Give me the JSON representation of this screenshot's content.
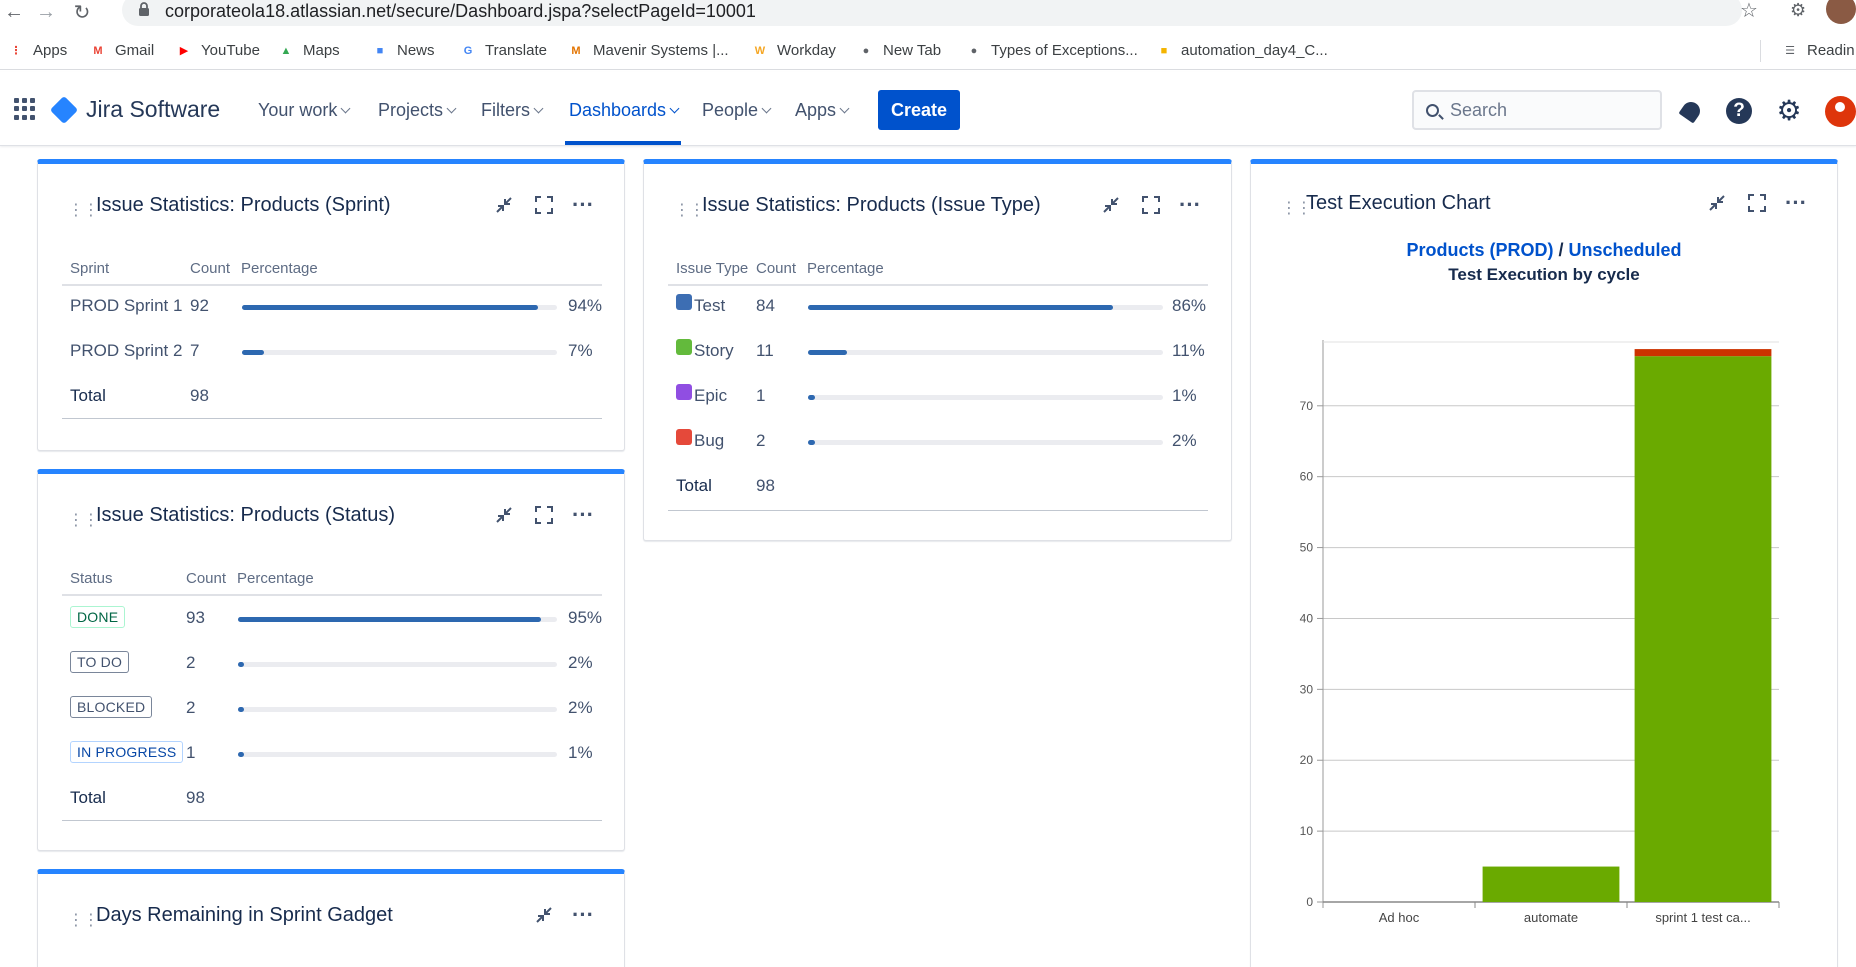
{
  "browser": {
    "url": "corporateola18.atlassian.net/secure/Dashboard.jspa?selectPageId=10001",
    "bookmarks": [
      {
        "label": "Apps",
        "icon": "apps-grid-icon",
        "color": "#ea4335"
      },
      {
        "label": "Gmail",
        "icon": "gmail-icon",
        "color": "#ea4335"
      },
      {
        "label": "YouTube",
        "icon": "youtube-icon",
        "color": "#ff0000"
      },
      {
        "label": "Maps",
        "icon": "maps-icon",
        "color": "#34a853"
      },
      {
        "label": "News",
        "icon": "news-icon",
        "color": "#4285f4"
      },
      {
        "label": "Translate",
        "icon": "translate-icon",
        "color": "#4285f4"
      },
      {
        "label": "Mavenir Systems |...",
        "icon": "mavenir-icon",
        "color": "#e37400"
      },
      {
        "label": "Workday",
        "icon": "workday-icon",
        "color": "#f5a623"
      },
      {
        "label": "New Tab",
        "icon": "globe-icon",
        "color": "#5f6368"
      },
      {
        "label": "Types of Exceptions...",
        "icon": "globe-icon",
        "color": "#5f6368"
      },
      {
        "label": "automation_day4_C...",
        "icon": "slides-icon",
        "color": "#f4b400"
      }
    ],
    "reading_list": "Readin"
  },
  "header": {
    "product": "Jira Software",
    "nav": [
      {
        "label": "Your work",
        "active": false
      },
      {
        "label": "Projects",
        "active": false
      },
      {
        "label": "Filters",
        "active": false
      },
      {
        "label": "Dashboards",
        "active": true
      },
      {
        "label": "People",
        "active": false
      },
      {
        "label": "Apps",
        "active": false
      }
    ],
    "create_label": "Create",
    "search_placeholder": "Search",
    "help_glyph": "?"
  },
  "gadgets": {
    "sprint": {
      "title": "Issue Statistics: Products (Sprint)",
      "columns": [
        "Sprint",
        "Count",
        "Percentage"
      ],
      "rows": [
        {
          "label": "PROD Sprint 1",
          "count": "92",
          "percent": "94%",
          "fraction": 0.94
        },
        {
          "label": "PROD Sprint 2",
          "count": "7",
          "percent": "7%",
          "fraction": 0.07
        }
      ],
      "total_label": "Total",
      "total": "98"
    },
    "issue_type": {
      "title": "Issue Statistics: Products (Issue Type)",
      "columns": [
        "Issue Type",
        "Count",
        "Percentage"
      ],
      "rows": [
        {
          "label": "Test",
          "count": "84",
          "percent": "86%",
          "fraction": 0.86,
          "icon": "test-icon",
          "color": "#3d6eb3"
        },
        {
          "label": "Story",
          "count": "11",
          "percent": "11%",
          "fraction": 0.11,
          "icon": "story-icon",
          "color": "#63ba3c"
        },
        {
          "label": "Epic",
          "count": "1",
          "percent": "1%",
          "fraction": 0.01,
          "icon": "epic-icon",
          "color": "#904ee2"
        },
        {
          "label": "Bug",
          "count": "2",
          "percent": "2%",
          "fraction": 0.02,
          "icon": "bug-icon",
          "color": "#e5493a"
        }
      ],
      "total_label": "Total",
      "total": "98"
    },
    "status": {
      "title": "Issue Statistics: Products (Status)",
      "columns": [
        "Status",
        "Count",
        "Percentage"
      ],
      "rows": [
        {
          "label": "DONE",
          "count": "93",
          "percent": "95%",
          "fraction": 0.95,
          "color": "#006644",
          "border": "#abf5d1"
        },
        {
          "label": "TO DO",
          "count": "2",
          "percent": "2%",
          "fraction": 0.02,
          "color": "#42526e",
          "border": "#7a869a"
        },
        {
          "label": "BLOCKED",
          "count": "2",
          "percent": "2%",
          "fraction": 0.02,
          "color": "#42526e",
          "border": "#7a869a"
        },
        {
          "label": "IN PROGRESS",
          "count": "1",
          "percent": "1%",
          "fraction": 0.01,
          "color": "#0747a6",
          "border": "#b3d4ff"
        }
      ],
      "total_label": "Total",
      "total": "98"
    },
    "days_remaining": {
      "title": "Days Remaining in Sprint Gadget"
    },
    "test_execution": {
      "title": "Test Execution Chart",
      "link_project": "Products (PROD)",
      "separator": "/",
      "link_version": "Unscheduled",
      "subtitle": "Test Execution by cycle"
    }
  },
  "chart_data": {
    "type": "bar",
    "title": "Test Execution by cycle",
    "categories": [
      "Ad hoc",
      "automate",
      "sprint 1 test ca..."
    ],
    "series": [
      {
        "values": [
          0,
          5,
          77
        ],
        "color": "#6aaa00"
      },
      {
        "values": [
          0,
          0,
          1
        ],
        "color": "#cc3300"
      }
    ],
    "stacked": true,
    "ylim": [
      0,
      79
    ],
    "yticks": [
      0,
      10,
      20,
      30,
      40,
      50,
      60,
      70
    ],
    "grid": true
  }
}
